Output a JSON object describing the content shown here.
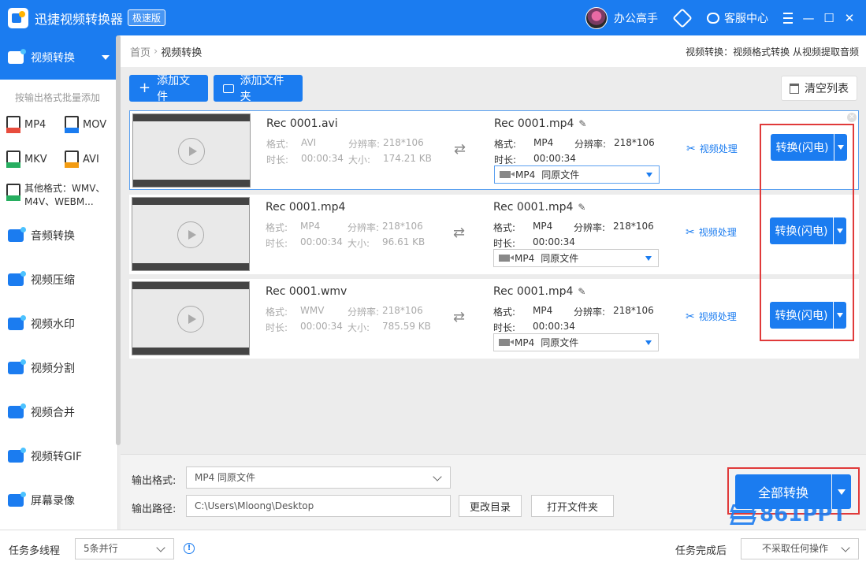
{
  "app": {
    "title": "迅捷视频转换器",
    "edition": "极速版",
    "user_name": "办公高手",
    "service_label": "客服中心"
  },
  "sidebar": {
    "active_label": "视频转换",
    "batch_hint": "按输出格式批量添加",
    "formats": [
      {
        "label": "MP4",
        "color": "#e84c3d"
      },
      {
        "label": "MOV",
        "color": "#1b7cf0"
      },
      {
        "label": "MKV",
        "color": "#27ae60"
      },
      {
        "label": "AVI",
        "color": "#f39c12"
      }
    ],
    "other_formats": "其他格式：WMV、M4V、WEBM...",
    "items": [
      {
        "label": "音频转换",
        "icon": "audio-convert-icon"
      },
      {
        "label": "视频压缩",
        "icon": "video-compress-icon"
      },
      {
        "label": "视频水印",
        "icon": "video-watermark-icon"
      },
      {
        "label": "视频分割",
        "icon": "video-split-icon"
      },
      {
        "label": "视频合并",
        "icon": "video-merge-icon"
      },
      {
        "label": "视频转GIF",
        "icon": "video-gif-icon"
      },
      {
        "label": "屏幕录像",
        "icon": "screen-record-icon"
      }
    ]
  },
  "breadcrumb": {
    "home": "首页",
    "current": "视频转换",
    "description": "视频转换：视频格式转换 从视频提取音频"
  },
  "toolbar": {
    "add_file": "添加文件",
    "add_folder": "添加文件夹",
    "clear_list": "清空列表"
  },
  "labels": {
    "format": "格式:",
    "resolution": "分辨率:",
    "duration": "时长:",
    "size": "大小:",
    "same_as_source": "同原文件",
    "process": "视频处理",
    "convert": "转换(闪电)"
  },
  "files": [
    {
      "src_name": "Rec 0001.avi",
      "src_format": "AVI",
      "src_resolution": "218*106",
      "src_duration": "00:00:34",
      "src_size": "174.21 KB",
      "dst_name": "Rec 0001.mp4",
      "dst_format": "MP4",
      "dst_resolution": "218*106",
      "dst_duration": "00:00:34",
      "output_format": "MP4"
    },
    {
      "src_name": "Rec 0001.mp4",
      "src_format": "MP4",
      "src_resolution": "218*106",
      "src_duration": "00:00:34",
      "src_size": "96.61 KB",
      "dst_name": "Rec 0001.mp4",
      "dst_format": "MP4",
      "dst_resolution": "218*106",
      "dst_duration": "00:00:34",
      "output_format": "MP4"
    },
    {
      "src_name": "Rec 0001.wmv",
      "src_format": "WMV",
      "src_resolution": "218*106",
      "src_duration": "00:00:34",
      "src_size": "785.59 KB",
      "dst_name": "Rec 0001.mp4",
      "dst_format": "MP4",
      "dst_resolution": "218*106",
      "dst_duration": "00:00:34",
      "output_format": "MP4"
    }
  ],
  "output": {
    "format_label": "输出格式:",
    "format_value": "MP4  同原文件",
    "path_label": "输出路径:",
    "path_value": "C:\\Users\\Mloong\\Desktop",
    "change_dir": "更改目录",
    "open_folder": "打开文件夹",
    "convert_all": "全部转换"
  },
  "status": {
    "threads_label": "任务多线程",
    "threads_value": "5条并行",
    "after_label": "任务完成后",
    "after_value": "不采取任何操作"
  },
  "watermark": "861PPT",
  "colors": {
    "accent": "#1b7cf0",
    "highlight_box": "#e03a3a"
  }
}
